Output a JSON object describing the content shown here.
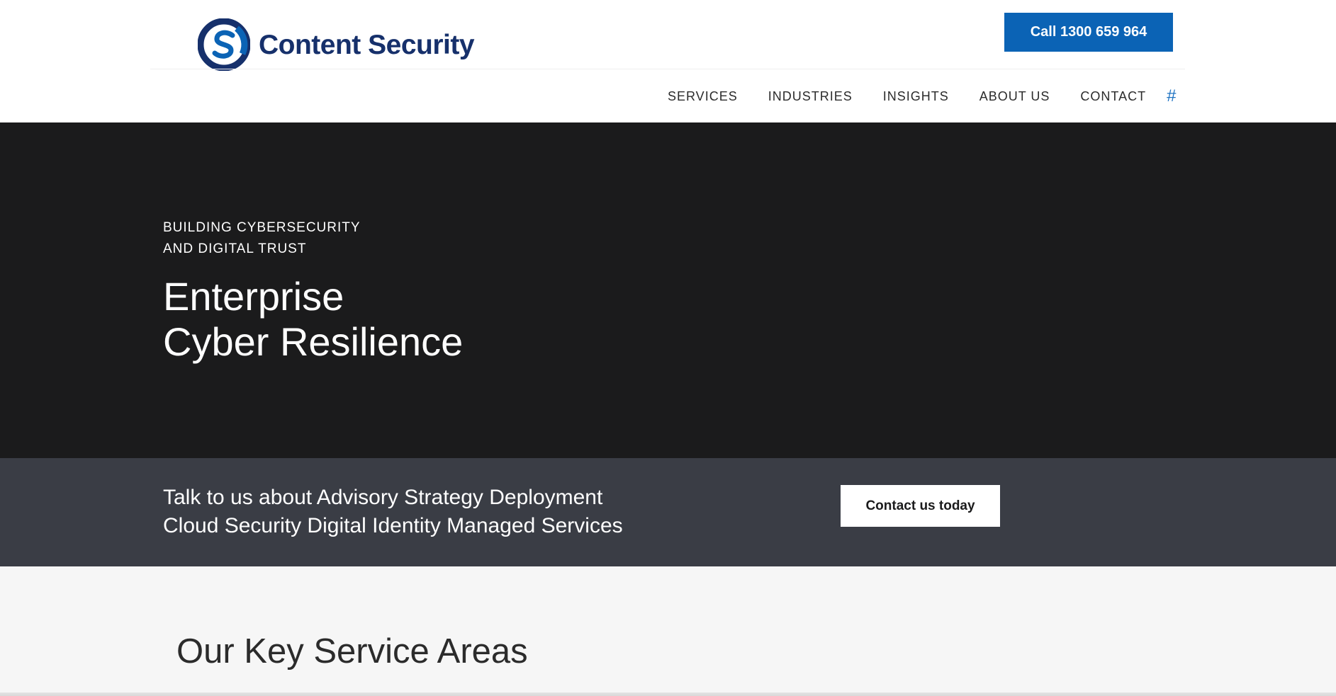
{
  "header": {
    "logo_text": "Content Security",
    "call_button": "Call 1300 659 964",
    "nav": [
      {
        "label": "SERVICES"
      },
      {
        "label": "INDUSTRIES"
      },
      {
        "label": "INSIGHTS"
      },
      {
        "label": "ABOUT US"
      },
      {
        "label": "CONTACT"
      }
    ],
    "search_glyph": "#"
  },
  "hero": {
    "eyebrow_line1": "BUILDING CYBERSECURITY",
    "eyebrow_line2": "AND DIGITAL TRUST",
    "title_line1": "Enterprise",
    "title_line2": "Cyber Resilience"
  },
  "cta_band": {
    "text_line1": "Talk to us about Advisory Strategy Deployment",
    "text_line2": "Cloud Security Digital Identity Managed Services",
    "button": "Contact us today"
  },
  "services": {
    "title": "Our Key Service Areas"
  },
  "colors": {
    "brand_navy": "#16306b",
    "brand_blue": "#0b63b5",
    "hero_bg": "#1b1b1c",
    "band_bg": "#3a3d45",
    "section_bg": "#f6f6f6"
  },
  "icons": {
    "logo": "cs-logo-mark",
    "nav_extra": "hash-icon"
  }
}
